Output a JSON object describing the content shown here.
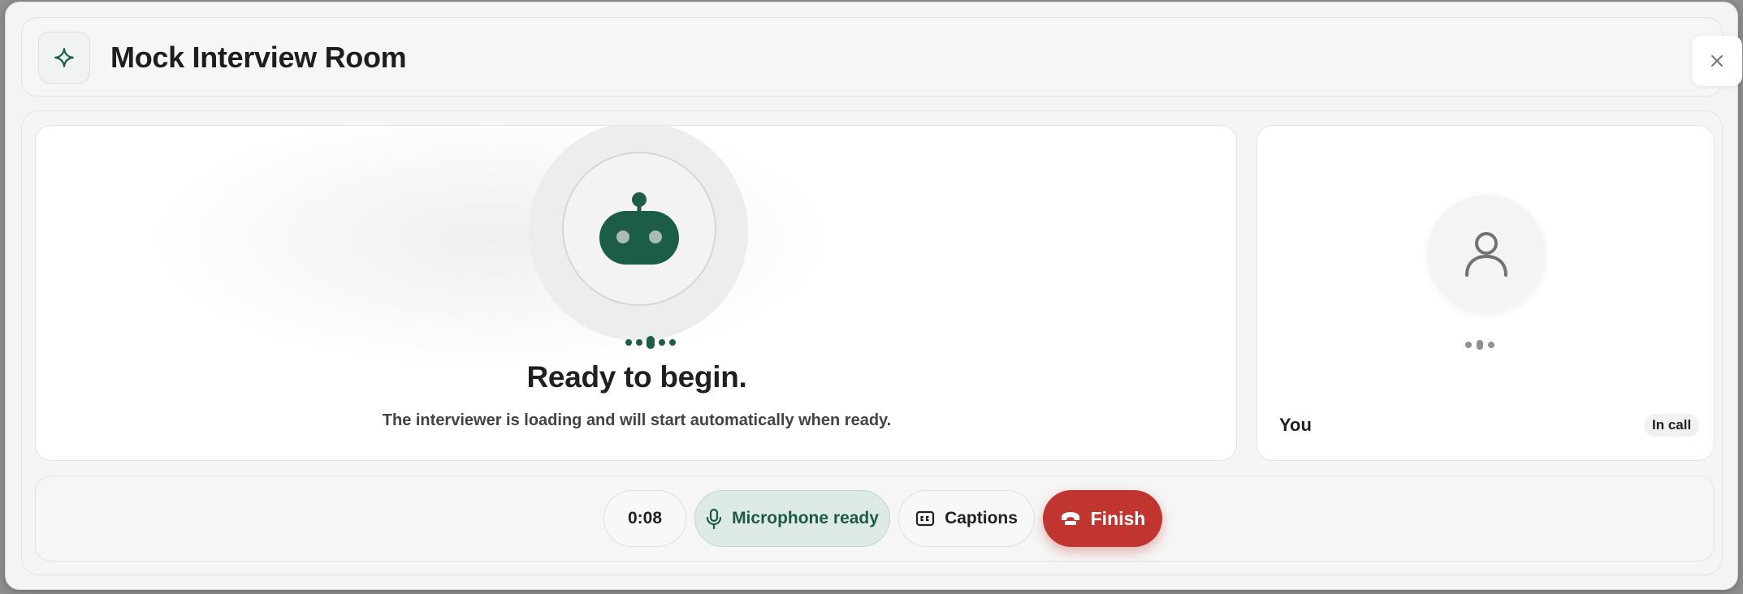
{
  "header": {
    "title": "Mock Interview Room",
    "app_icon": "sparkle-icon",
    "close_icon": "close-icon"
  },
  "interviewer": {
    "avatar_icon": "robot-icon",
    "status_title": "Ready to begin.",
    "status_subtitle": "The interviewer is loading and will start automatically when ready."
  },
  "participant": {
    "avatar_icon": "user-icon",
    "name": "You",
    "status_badge": "In call"
  },
  "controls": {
    "timer": "0:08",
    "microphone_label": "Microphone ready",
    "microphone_icon": "microphone-icon",
    "captions_label": "Captions",
    "captions_icon": "closed-captions-icon",
    "finish_label": "Finish",
    "finish_icon": "hang-up-icon"
  },
  "colors": {
    "accent_green": "#1c5d48",
    "finish_red": "#c0352f",
    "mic_ready_bg": "#deebe5"
  }
}
